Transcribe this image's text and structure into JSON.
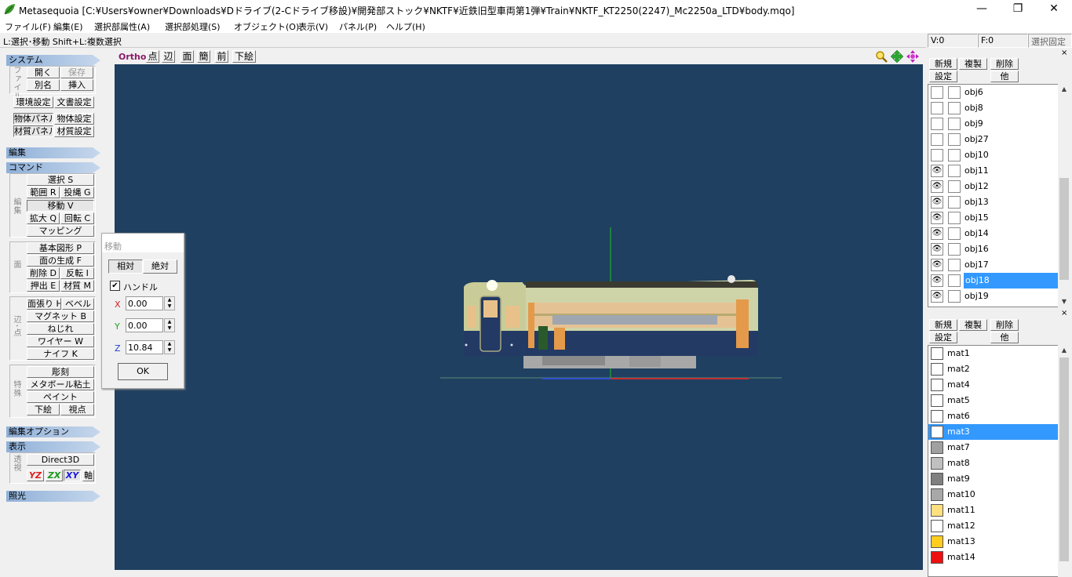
{
  "window": {
    "title": "Metasequoia [C:¥Users¥owner¥Downloads¥Dドライブ(2-Cドライブ移設)¥開発部ストック¥NKTF¥近鉄旧型車両第1弾¥Train¥NKTF_KT2250(2247)_Mc2250a_LTD¥body.mqo]",
    "minimize": "—",
    "maximize": "❐",
    "close": "✕"
  },
  "menu": [
    "ファイル(F)",
    "編集(E)",
    "選択部属性(A)",
    "選択部処理(S)",
    "オブジェクト(O)",
    "表示(V)",
    "パネル(P)",
    "ヘルプ(H)"
  ],
  "hint": "L:選択･移動  Shift+L:複数選択",
  "status": {
    "v": "V:0",
    "f": "F:0",
    "lock": "選択固定"
  },
  "left": {
    "system": "システム",
    "file_label": "ファイル",
    "open": "開く",
    "save": "保存",
    "saveas": "別名",
    "insert": "挿入",
    "env": "環境設定",
    "doc": "文書設定",
    "objpanel": "物体パネル",
    "objset": "物体設定",
    "matpanel": "材質パネル",
    "matset": "材質設定",
    "edit": "編集",
    "command": "コマンド",
    "edit_label": "編集",
    "select": "選択 S",
    "range": "範囲 R",
    "lasso": "投縄 G",
    "move": "移動 V",
    "scale": "拡大 Q",
    "rotate": "回転 C",
    "mapping": "マッピング",
    "face_label": "面",
    "basic": "基本図形 P",
    "facegen": "面の生成 F",
    "delete": "削除 D",
    "flip": "反転 I",
    "extrude": "押出 E",
    "material": "材質 M",
    "edge_label": "辺･点",
    "stretch": "面張り H",
    "bevel": "ベベル",
    "magnet": "マグネット B",
    "twist": "ねじれ",
    "wire": "ワイヤー W",
    "knife": "ナイフ K",
    "special_label": "特殊",
    "sculpt": "彫刻",
    "metaball": "メタボール粘土",
    "paint": "ペイント",
    "underlay": "下絵",
    "viewpoint": "視点",
    "editopt": "編集オプション",
    "display": "表示",
    "persp_label": "透視",
    "direct3d": "Direct3D",
    "yz": "YZ",
    "zx": "ZX",
    "xy": "XY",
    "axis": "軸",
    "light": "照光"
  },
  "viewtool": {
    "ortho": "Ortho",
    "point": "点",
    "edge": "辺",
    "face": "面",
    "simple": "簡",
    "front": "前",
    "underlay": "下絵"
  },
  "movedlg": {
    "title": "移動",
    "relative": "相対",
    "absolute": "絶対",
    "handle": "ハンドル",
    "x_label": "X",
    "y_label": "Y",
    "z_label": "Z",
    "x": "0.00",
    "y": "0.00",
    "z": "10.84",
    "ok": "OK"
  },
  "objpanel": {
    "new": "新規",
    "dup": "複製",
    "del": "削除",
    "set": "設定",
    "other": "他",
    "items": [
      {
        "name": "obj6",
        "visible": false
      },
      {
        "name": "obj8",
        "visible": false
      },
      {
        "name": "obj9",
        "visible": false
      },
      {
        "name": "obj27",
        "visible": false
      },
      {
        "name": "obj10",
        "visible": false
      },
      {
        "name": "obj11",
        "visible": true
      },
      {
        "name": "obj12",
        "visible": true
      },
      {
        "name": "obj13",
        "visible": true
      },
      {
        "name": "obj15",
        "visible": true
      },
      {
        "name": "obj14",
        "visible": true
      },
      {
        "name": "obj16",
        "visible": true
      },
      {
        "name": "obj17",
        "visible": true
      },
      {
        "name": "obj18",
        "visible": true,
        "selected": true
      },
      {
        "name": "obj19",
        "visible": true
      }
    ]
  },
  "matpanel": {
    "new": "新規",
    "dup": "複製",
    "del": "削除",
    "set": "設定",
    "other": "他",
    "items": [
      {
        "name": "mat1",
        "color": "#ffffff"
      },
      {
        "name": "mat2",
        "color": "#ffffff"
      },
      {
        "name": "mat4",
        "color": "#ffffff"
      },
      {
        "name": "mat5",
        "color": "#ffffff"
      },
      {
        "name": "mat6",
        "color": "#ffffff"
      },
      {
        "name": "mat3",
        "color": "#ffffff",
        "selected": true
      },
      {
        "name": "mat7",
        "color": "#a0a0a0"
      },
      {
        "name": "mat8",
        "color": "#c0c0c0"
      },
      {
        "name": "mat9",
        "color": "#808080"
      },
      {
        "name": "mat10",
        "color": "#a8a8a8"
      },
      {
        "name": "mat11",
        "color": "#ffe080"
      },
      {
        "name": "mat12",
        "color": "#ffffff"
      },
      {
        "name": "mat13",
        "color": "#ffcc20"
      },
      {
        "name": "mat14",
        "color": "#ee1010"
      }
    ]
  }
}
